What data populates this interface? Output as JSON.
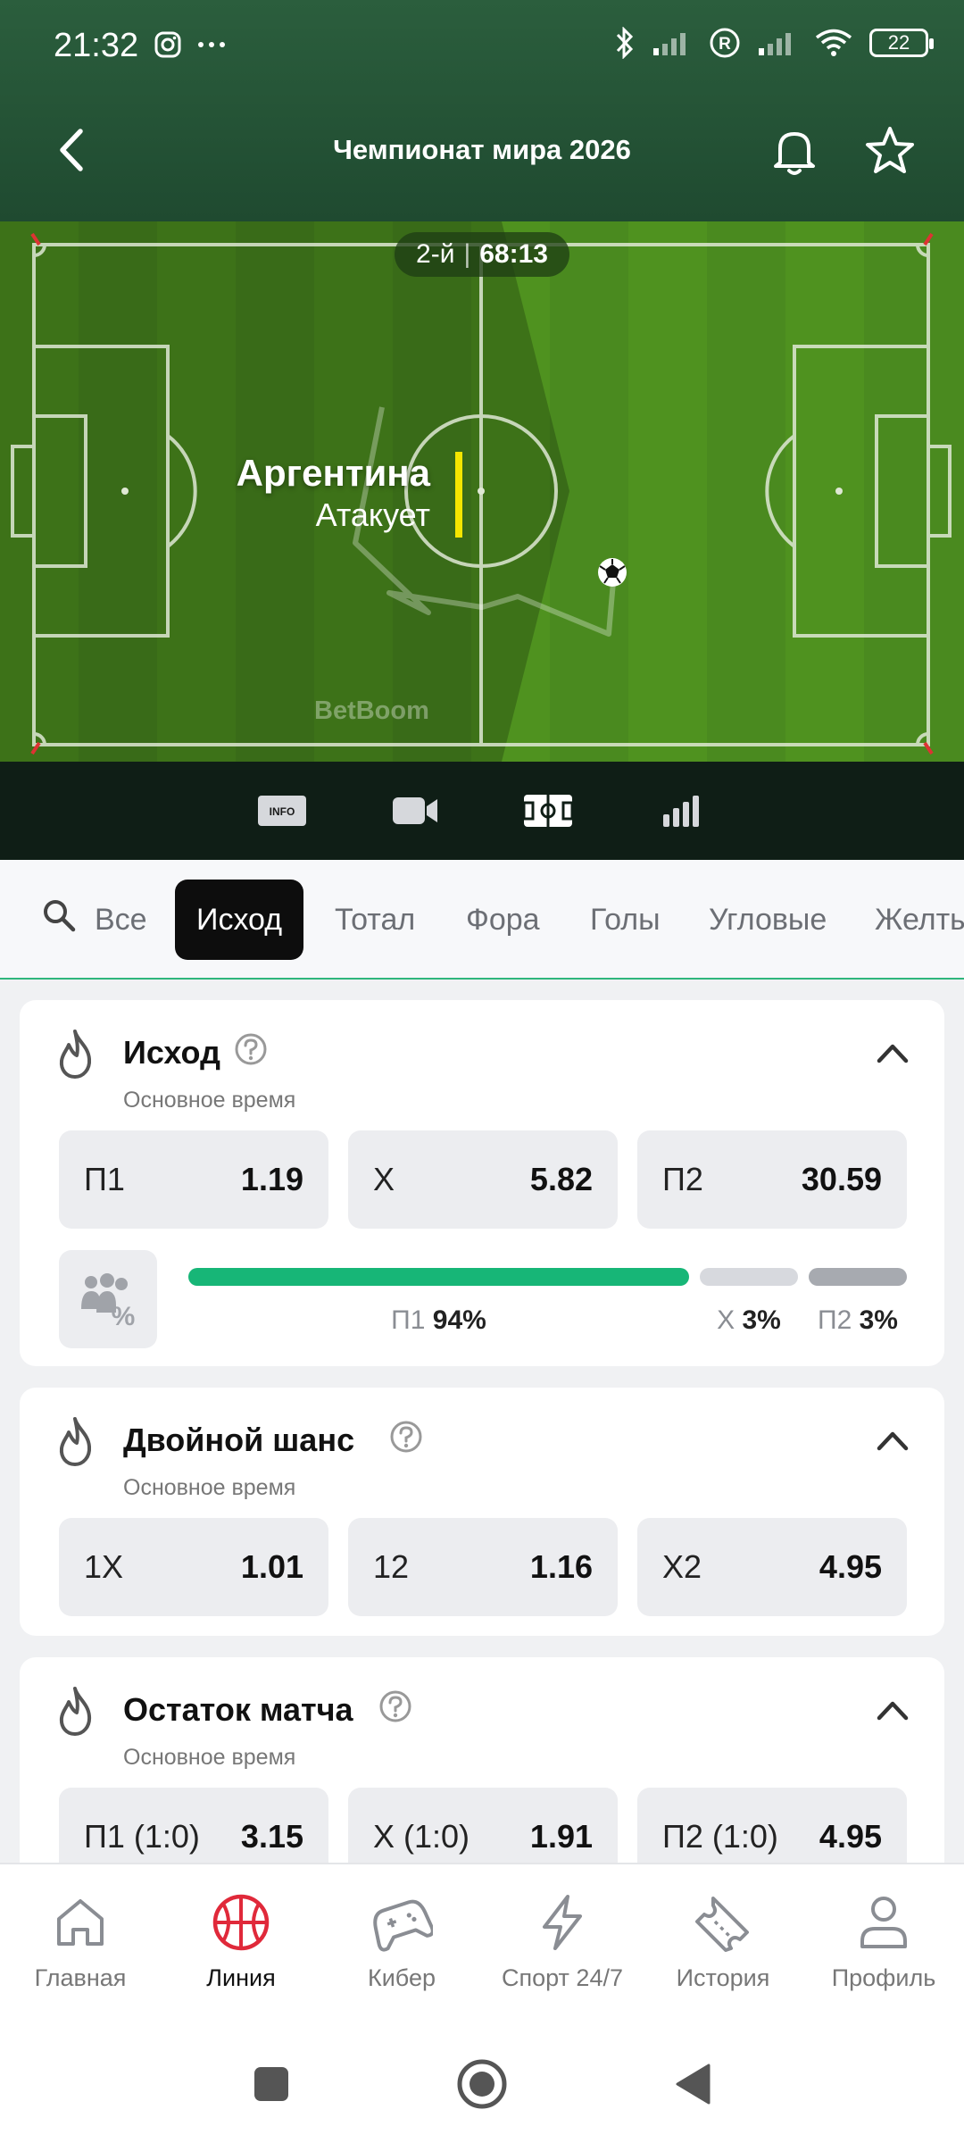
{
  "status_bar": {
    "time": "21:32",
    "battery": "22",
    "icons": [
      "instagram-icon",
      "more-icon",
      "bluetooth-icon",
      "signal-icon",
      "roaming-icon",
      "signal-icon",
      "wifi-icon",
      "battery-icon"
    ]
  },
  "header": {
    "title": "Чемпионат мира 2026",
    "icons": [
      "back-icon",
      "bell-icon",
      "star-icon"
    ]
  },
  "match": {
    "period": "2-й",
    "separator": "|",
    "clock": "68:13",
    "team": "Аргентина",
    "state": "Атакует",
    "watermark": "BetBoom",
    "colors": {
      "pitch": "#4a8a1f",
      "attack_bar": "#f5e600"
    }
  },
  "media_tabs": {
    "info_label": "INFO",
    "icons": [
      "info-icon",
      "video-icon",
      "field-icon",
      "stats-icon"
    ]
  },
  "filters": {
    "tabs": [
      "Все",
      "Исход",
      "Тотал",
      "Фора",
      "Голы",
      "Угловые",
      "Желтые"
    ],
    "active": "Исход"
  },
  "markets": [
    {
      "title": "Исход",
      "subtitle": "Основное время",
      "odds": [
        {
          "label": "П1",
          "value": "1.19"
        },
        {
          "label": "X",
          "value": "5.82"
        },
        {
          "label": "П2",
          "value": "30.59"
        }
      ],
      "bet_share": [
        {
          "key": "П1",
          "value": "94%",
          "share": 0.94,
          "color": "#17b677"
        },
        {
          "key": "X",
          "value": "3%",
          "share": 0.03,
          "color": "#d7d9de"
        },
        {
          "key": "П2",
          "value": "3%",
          "share": 0.03,
          "color": "#a7aab0"
        }
      ]
    },
    {
      "title": "Двойной шанс",
      "subtitle": "Основное время",
      "odds": [
        {
          "label": "1X",
          "value": "1.01"
        },
        {
          "label": "12",
          "value": "1.16"
        },
        {
          "label": "X2",
          "value": "4.95"
        }
      ]
    },
    {
      "title": "Остаток матча",
      "subtitle": "Основное время",
      "odds": [
        {
          "label": "П1 (1:0)",
          "value": "3.15"
        },
        {
          "label": "X (1:0)",
          "value": "1.91"
        },
        {
          "label": "П2 (1:0)",
          "value": "4.95"
        }
      ]
    }
  ],
  "bottom_nav": {
    "items": [
      {
        "label": "Главная",
        "icon": "home-icon"
      },
      {
        "label": "Линия",
        "icon": "basketball-icon"
      },
      {
        "label": "Кибер",
        "icon": "gamepad-icon"
      },
      {
        "label": "Спорт 24/7",
        "icon": "lightning-icon"
      },
      {
        "label": "История",
        "icon": "ticket-icon"
      },
      {
        "label": "Профиль",
        "icon": "profile-icon"
      }
    ],
    "active": "Линия",
    "accent": "#e0293a"
  }
}
